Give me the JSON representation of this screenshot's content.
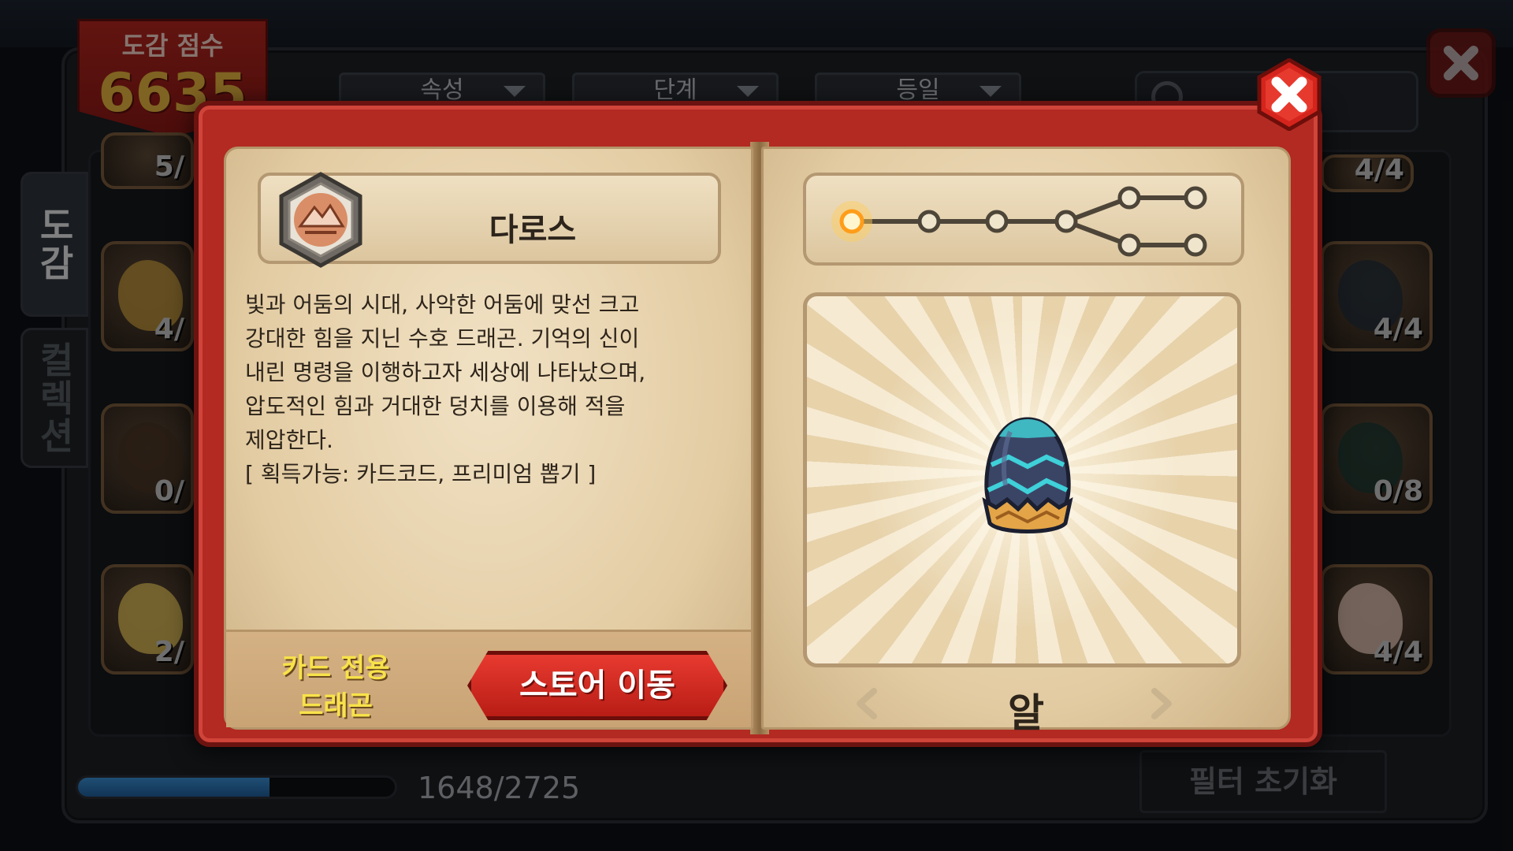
{
  "collection": {
    "score_label": "도감 점수",
    "score_value": "6635",
    "filters": [
      {
        "label": "속성"
      },
      {
        "label": "단계"
      },
      {
        "label": "등일"
      }
    ],
    "side_tabs": [
      {
        "label": "도감",
        "active": true
      },
      {
        "label": "컬렉션",
        "active": false
      }
    ],
    "left_cards": [
      {
        "count": "5/"
      },
      {
        "count": "4/"
      },
      {
        "count": "0/"
      },
      {
        "count": "2/"
      }
    ],
    "right_cards": [
      {
        "count": "4/4"
      },
      {
        "count": "4/4"
      },
      {
        "count": "0/8"
      },
      {
        "count": "4/4"
      }
    ],
    "progress": {
      "current": 1648,
      "total": 2725,
      "text": "1648/2725",
      "fraction": 0.605
    },
    "reset_button": "필터 초기화"
  },
  "dialog": {
    "dragon_name": "다로스",
    "element_icon": "mountain-element-icon",
    "description": "빛과 어둠의 시대, 사악한 어둠에 맞선 크고\n강대한 힘을 지닌 수호 드래곤. 기억의 신이\n내린 명령을 이행하고자 세상에 나타났으며,\n압도적인 힘과 거대한 덩치를 이용해 적을\n제압한다.\n[ 획득가능: 카드코드, 프리미엄 뽑기 ]",
    "card_only_line1": "카드 전용",
    "card_only_line2": "드래곤",
    "store_button": "스토어 이동",
    "stage_label": "알",
    "evolution": {
      "current_stage": 1,
      "linear_stages": 4,
      "branches": 2,
      "branch_stages": 2
    },
    "colors": {
      "book_red": "#b22a22",
      "highlight_yellow": "#f8e24a",
      "store_red": "#e83a30",
      "active_node": "#ffb52e"
    }
  }
}
